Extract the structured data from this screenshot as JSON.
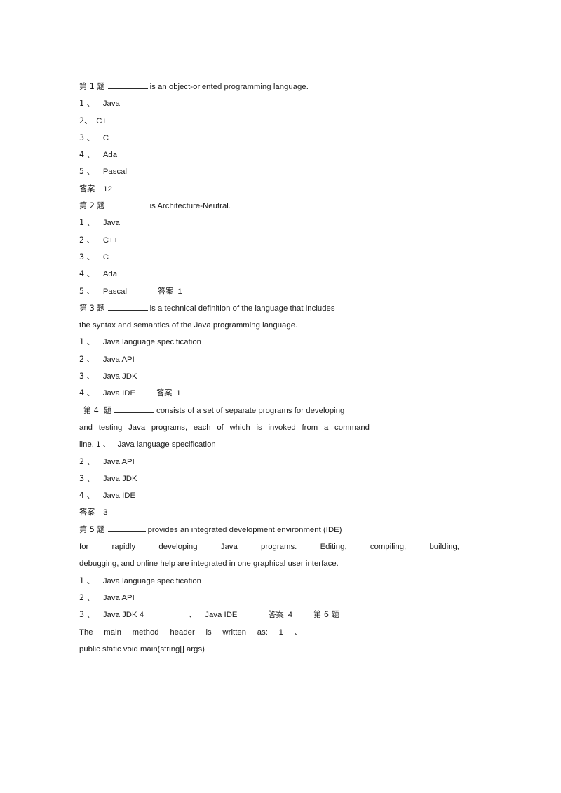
{
  "document": {
    "type": "exam-question-sheet",
    "background_color": "#ffffff",
    "text_color": "#1a1a1a",
    "questions": [
      {
        "number_label": "第 1 题",
        "stem_before_blank": "第 1 题",
        "stem_after_blank": "is an object-oriented programming language.",
        "options": [
          {
            "marker": "1 、",
            "text": "Java"
          },
          {
            "marker": "2、",
            "text": "C++"
          },
          {
            "marker": "3 、",
            "text": "C"
          },
          {
            "marker": "4 、",
            "text": "Ada"
          },
          {
            "marker": "5 、",
            "text": "Pascal"
          }
        ],
        "answer_label": "答案",
        "answer_value": "12"
      },
      {
        "number_label": "第 2 题",
        "stem_after_blank": "is Architecture-Neutral.",
        "options": [
          {
            "marker": "1 、",
            "text": "Java"
          },
          {
            "marker": "2 、",
            "text": "C++"
          },
          {
            "marker": "3 、",
            "text": "C"
          },
          {
            "marker": "4 、",
            "text": "Ada"
          },
          {
            "marker": "5 、",
            "text": "Pascal"
          }
        ],
        "answer_label": "答案",
        "answer_value": "1"
      },
      {
        "number_label": "第 3 题",
        "stem_after_blank": "is a technical definition of the language that includes",
        "stem_line2": "the syntax and semantics of the Java programming language.",
        "options": [
          {
            "marker": "1 、",
            "text": "Java language specification"
          },
          {
            "marker": "2 、",
            "text": "Java API"
          },
          {
            "marker": "3 、",
            "text": "Java JDK"
          },
          {
            "marker": "4 、",
            "text": "Java IDE"
          }
        ],
        "answer_label": "答案",
        "answer_value": "1"
      },
      {
        "number_label": "第 4  题",
        "stem_after_blank": "consists of a set of separate programs for developing",
        "stem_line2": "and testing Java programs, each of which is invoked from a command",
        "stem_line3": "line. 1 、   Java language specification",
        "options": [
          {
            "marker": "2 、",
            "text": "Java API"
          },
          {
            "marker": "3 、",
            "text": "Java JDK"
          },
          {
            "marker": "4 、",
            "text": "Java IDE"
          }
        ],
        "answer_label": "答案",
        "answer_value": "3"
      },
      {
        "number_label": "第 5 题",
        "stem_after_blank": "provides an integrated development environment (IDE)",
        "stem_line2": "for rapidly developing Java programs. Editing, compiling, building,",
        "stem_line3": "debugging, and online help are integrated in one graphical user interface.",
        "options": [
          {
            "marker": "1 、",
            "text": "Java language specification"
          },
          {
            "marker": "2 、",
            "text": "Java API"
          }
        ],
        "trailing_line": {
          "marker": "3 、",
          "text": "Java JDK 4",
          "sep": "、",
          "text2": "Java IDE",
          "answer_label": "答案",
          "answer_value": "4",
          "next_question_label": "第 6 题"
        }
      },
      {
        "number_label": "第 6 题",
        "stem_line1": "The main method header is written as: 1 、",
        "stem_line2": "public static void main(string[] args)"
      }
    ]
  },
  "lines": {
    "q1_stem_after": "is an object-oriented programming language.",
    "q1_head": "第 1 题",
    "q1_o1_m": "1 、",
    "q1_o1_t": "Java",
    "q1_o2_m": "2、",
    "q1_o2_t": "C++",
    "q1_o3_m": "3 、",
    "q1_o3_t": "C",
    "q1_o4_m": "4 、",
    "q1_o4_t": "Ada",
    "q1_o5_m": "5 、",
    "q1_o5_t": "Pascal",
    "q1_ans_l": "答案",
    "q1_ans_v": "12",
    "q2_head": "第 2 题",
    "q2_stem_after": "is Architecture-Neutral.",
    "q2_o1_m": "1 、",
    "q2_o1_t": "Java",
    "q2_o2_m": "2 、",
    "q2_o2_t": "C++",
    "q2_o3_m": "3 、",
    "q2_o3_t": "C",
    "q2_o4_m": "4 、",
    "q2_o4_t": "Ada",
    "q2_o5_m": "5 、",
    "q2_o5_t": "Pascal",
    "q2_ans_l": "答案",
    "q2_ans_v": "1",
    "q3_head": "第 3 题",
    "q3_stem_after": "is a technical definition of the language that includes",
    "q3_stem_l2": "the syntax and semantics of the Java programming language.",
    "q3_o1_m": "1 、",
    "q3_o1_t": "Java language specification",
    "q3_o2_m": "2 、",
    "q3_o2_t": "Java API",
    "q3_o3_m": "3 、",
    "q3_o3_t": "Java JDK",
    "q3_o4_m": "4 、",
    "q3_o4_t": "Java IDE",
    "q3_ans_l": "答案",
    "q3_ans_v": "1",
    "q4_head": "第 4  题",
    "q4_stem_after": "consists of a set of separate programs for developing",
    "q4_stem_l2": "and testing Java programs, each of which is invoked from a command",
    "q4_stem_l3": "line. 1 、   Java language specification",
    "q4_o2_m": "2 、",
    "q4_o2_t": "Java API",
    "q4_o3_m": "3 、",
    "q4_o3_t": "Java JDK",
    "q4_o4_m": "4 、",
    "q4_o4_t": "Java IDE",
    "q4_ans_l": "答案",
    "q4_ans_v": "3",
    "q5_head": "第 5 题",
    "q5_stem_after": "provides an integrated development environment (IDE)",
    "q5_stem_l2": "for rapidly developing Java programs. Editing, compiling, building,",
    "q5_stem_l3": "debugging, and online help are integrated in one graphical user interface.",
    "q5_o1_m": "1 、",
    "q5_o1_t": "Java language specification",
    "q5_o2_m": "2 、",
    "q5_o2_t": "Java API",
    "q5_o3_m": "3 、",
    "q5_o3_t": "Java JDK 4",
    "q5_sep": "、",
    "q5_o4_t": "Java IDE",
    "q5_ans_l": "答案",
    "q5_ans_v": "4",
    "q6_head": "第 6 题",
    "q6_l1": "The main method header is written as: 1 、",
    "q6_l2": "public static void main(string[] args)"
  }
}
